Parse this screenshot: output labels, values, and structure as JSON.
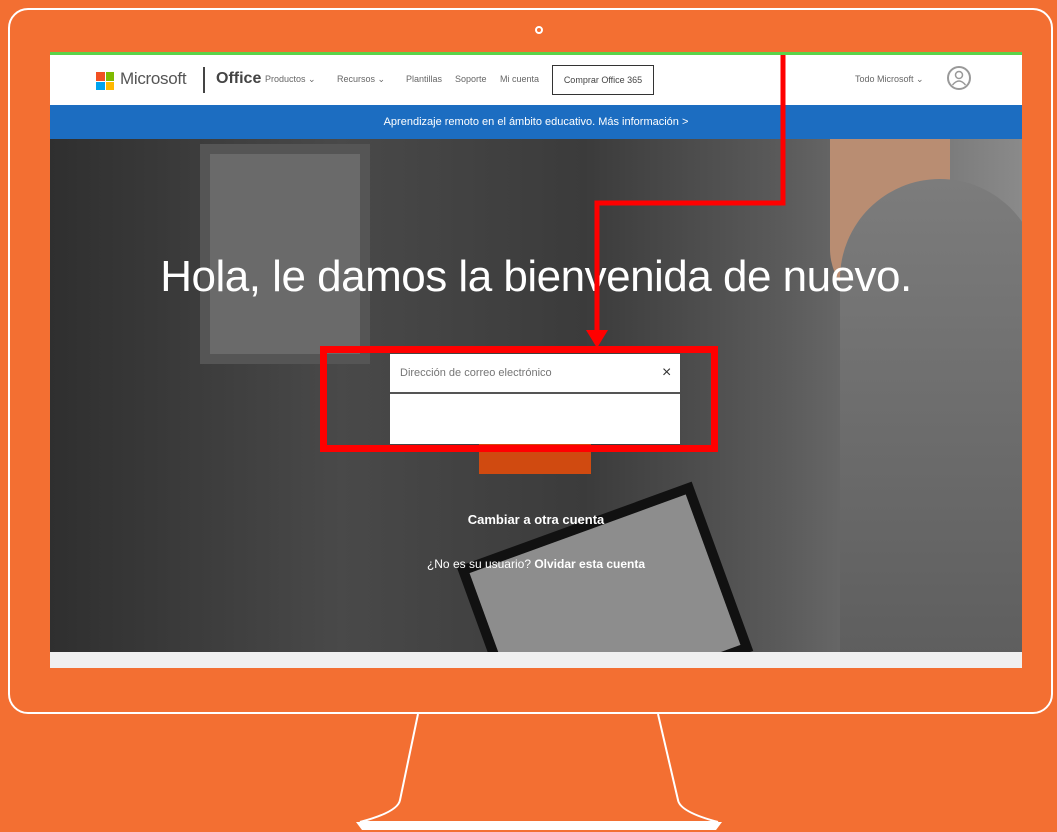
{
  "header": {
    "brand": "Microsoft",
    "product": "Office",
    "nav": [
      "Productos ⌄",
      "Recursos ⌄",
      "Plantillas",
      "Soporte",
      "Mi cuenta"
    ],
    "buy_label": "Comprar Office 365",
    "all_microsoft": "Todo Microsoft ⌄"
  },
  "banner": {
    "text": "Aprendizaje remoto en el ámbito educativo. Más información >"
  },
  "hero": {
    "welcome": "Hola, le damos la bienvenida de nuevo.",
    "email_placeholder": "Dirección de correo electrónico",
    "close_glyph": "×",
    "switch_account": "Cambiar a otra cuenta",
    "not_user_prefix": "¿No es su usuario?",
    "forget_account": "Olvidar esta cuenta"
  },
  "colors": {
    "background": "#F36F32",
    "banner": "#1C6DC1",
    "highlight": "#FF0000"
  },
  "icons": [
    "microsoft-logo-icon",
    "user-icon",
    "close-icon",
    "arrow-icon"
  ]
}
